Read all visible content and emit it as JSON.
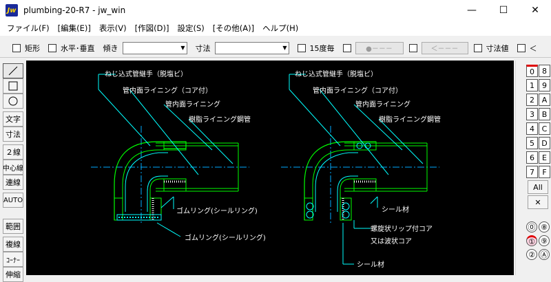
{
  "window": {
    "title": "plumbing-20-R7 - jw_win",
    "app_icon_text": "Jw",
    "minimize_glyph": "—",
    "maximize_glyph": "☐",
    "close_glyph": "✕"
  },
  "menu": [
    "ファイル(F)",
    "[編集(E)]",
    "表示(V)",
    "[作図(D)]",
    "設定(S)",
    "[その他(A)]",
    "ヘルプ(H)"
  ],
  "toolbar": {
    "rect_label": "矩形",
    "hv_label": "水平･垂直",
    "slope_label": "傾き",
    "dim_label": "寸法",
    "deg15_label": "15度毎",
    "btn1_label": "●－－－",
    "btn2_label": "＜－－－",
    "dimval_label": "寸法値",
    "last_label": "＜"
  },
  "left_tools": {
    "text": "文字",
    "dim": "寸法",
    "double_line": "２線",
    "center_line": "中心線",
    "continuous_line": "連線",
    "auto": "AUTO",
    "range": "範囲",
    "copy_line": "複線",
    "corner": "ｺｰﾅｰ",
    "extend": "伸縮"
  },
  "right_tools": {
    "layer_group_buttons": [
      "0",
      "8",
      "1",
      "9",
      "2",
      "A",
      "3",
      "B",
      "4",
      "C",
      "5",
      "D",
      "6",
      "E",
      "7",
      "F"
    ],
    "all_label": "All",
    "x_glyph": "✕",
    "layer_buttons": [
      "0",
      "8",
      "1",
      "9",
      "2",
      "A"
    ],
    "layer_round_glyphs": [
      "⓪",
      "⑧",
      "①",
      "⑨",
      "②",
      "Ⓐ"
    ]
  },
  "drawing": {
    "left": {
      "label1": "ねじ込式管継手（脱塩ビ）",
      "label2": "管内面ライニング（コア付）",
      "label3": "管内面ライニング",
      "label4": "樹脂ライニング鋼管",
      "label5": "ゴムリング(シールリング)",
      "label6": "ゴムリング(シールリング)"
    },
    "right": {
      "label1": "ねじ込式管継手（脱塩ビ）",
      "label2": "管内面ライニング（コア付）",
      "label3": "管内面ライニング",
      "label4": "樹脂ライニング鋼管",
      "label5": "シール材",
      "label6": "螺旋状リップ付コア",
      "label7": "又は波状コア",
      "label8": "シール材"
    }
  },
  "colors": {
    "canvas_bg": "#000000",
    "outline": "#00ff00",
    "text": "#ffffff",
    "cyan": "#00ffff",
    "center_line": "#00aaff",
    "active_layer_mark": "#e00000"
  }
}
